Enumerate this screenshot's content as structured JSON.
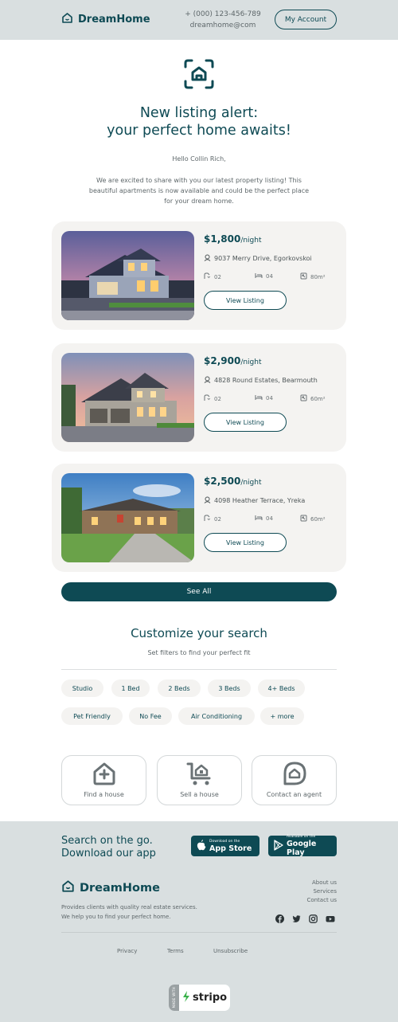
{
  "colors": {
    "brand": "#0e4a54",
    "background": "#d9dfe0",
    "card": "#f4f3f1"
  },
  "header": {
    "brand": "DreamHome",
    "phone": "+ (000) 123-456-789",
    "email": "dreamhome@com",
    "account_label": "My Account"
  },
  "hero": {
    "icon": "home-scan-icon",
    "title_line1": "New listing alert:",
    "title_line2": "your perfect home awaits!",
    "greeting": "Hello Collin Rich,",
    "intro_line1": "We are excited to share with you our latest property listing! This",
    "intro_line2": "beautiful apartments is now available and could be the perfect place",
    "intro_line3": "for your dream home."
  },
  "listings": [
    {
      "price": "$1,800",
      "per": "/night",
      "address": "9037 Merry Drive, Egorkovskoi",
      "baths": "02",
      "beds": "04",
      "area": "80m²",
      "button": "View Listing"
    },
    {
      "price": "$2,900",
      "per": "/night",
      "address": "4828 Round Estates, Bearmouth",
      "baths": "02",
      "beds": "04",
      "area": "60m²",
      "button": "View Listing"
    },
    {
      "price": "$2,500",
      "per": "/night",
      "address": "4098 Heather Terrace, Yreka",
      "baths": "02",
      "beds": "04",
      "area": "60m²",
      "button": "View Listing"
    }
  ],
  "see_all": "See All",
  "customize": {
    "title": "Customize your search",
    "subtitle": "Set filters to find your perfect fit",
    "chips_row1": [
      "Studio",
      "1 Bed",
      "2 Beds",
      "3 Beds",
      "4+ Beds"
    ],
    "chips_row2": [
      "Pet Friendly",
      "No Fee",
      "Air Conditioning",
      "+ more"
    ]
  },
  "actions": [
    {
      "label": "Find a house",
      "icon": "house-plus-icon"
    },
    {
      "label": "Sell a house",
      "icon": "cart-house-icon"
    },
    {
      "label": "Contact an agent",
      "icon": "chat-house-icon"
    }
  ],
  "footer": {
    "app_line1": "Search on the go.",
    "app_line2": "Download our app",
    "appstore_small": "Download on the",
    "appstore_big": "App Store",
    "gplay_small": "Available on the",
    "gplay_big": "Google Play",
    "brand": "DreamHome",
    "about": "About us",
    "services": "Services",
    "contact": "Contact us",
    "desc_line1": "Provides clients with quality real estate services.",
    "desc_line2": "We help you to find your perfect home.",
    "social": [
      "facebook-icon",
      "twitter-icon",
      "instagram-icon",
      "youtube-icon"
    ],
    "privacy": "Privacy",
    "terms": "Terms",
    "unsubscribe": "Unsubscribe",
    "stripo": "stripo",
    "stripo_tag": "MADE WITH"
  }
}
